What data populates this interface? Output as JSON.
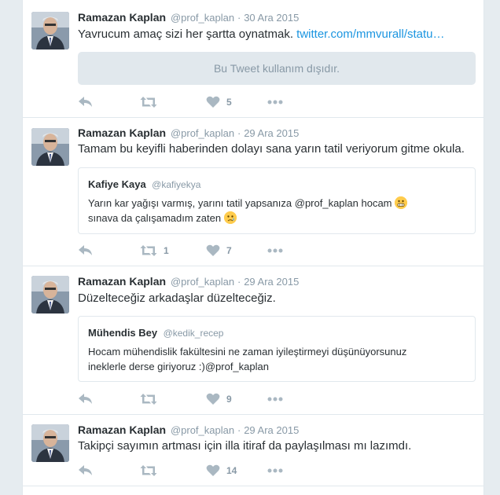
{
  "tweets": [
    {
      "fullname": "Ramazan Kaplan",
      "username": "@prof_kaplan",
      "separator": "·",
      "time": "30 Ara 2015",
      "text": "Yavrucum amaç sizi her şartta oynatmak.",
      "link": "twitter.com/mmvurall/statu…",
      "unavailable": "Bu Tweet kullanım dışıdır.",
      "retweets": "",
      "likes": "5"
    },
    {
      "fullname": "Ramazan Kaplan",
      "username": "@prof_kaplan",
      "separator": "·",
      "time": "29 Ara 2015",
      "text": "Tamam bu keyifli haberinden dolayı sana yarın tatil veriyorum gitme okula.",
      "quote": {
        "name": "Kafiye Kaya",
        "user": "@kafiyekya",
        "line1": "Yarın kar yağışı varmış, yarını tatil yapsanıza @prof_kaplan hocam",
        "line2": "sınava da çalışamadım zaten"
      },
      "retweets": "1",
      "likes": "7"
    },
    {
      "fullname": "Ramazan Kaplan",
      "username": "@prof_kaplan",
      "separator": "·",
      "time": "29 Ara 2015",
      "text": "Düzelteceğiz arkadaşlar düzelteceğiz.",
      "quote": {
        "name": "Mühendis Bey",
        "user": "@kedik_recep",
        "line1": "Hocam mühendislik fakültesini ne zaman iyileştirmeyi düşünüyorsunuz",
        "line2": "ineklerle derse giriyoruz :)@prof_kaplan"
      },
      "retweets": "",
      "likes": "9"
    },
    {
      "fullname": "Ramazan Kaplan",
      "username": "@prof_kaplan",
      "separator": "·",
      "time": "29 Ara 2015",
      "text": "Takipçi sayımın artması için illa itiraf da paylaşılması mı lazımdı.",
      "retweets": "",
      "likes": "14"
    }
  ],
  "icons": {
    "reply": "reply-icon",
    "retweet": "retweet-icon",
    "like": "heart-icon",
    "more": "more-icon"
  },
  "colors": {
    "link": "#1b95e0",
    "muted": "#8899a6",
    "icon": "#aab8c2",
    "border": "#e1e8ed",
    "background": "#e6ecf0"
  }
}
